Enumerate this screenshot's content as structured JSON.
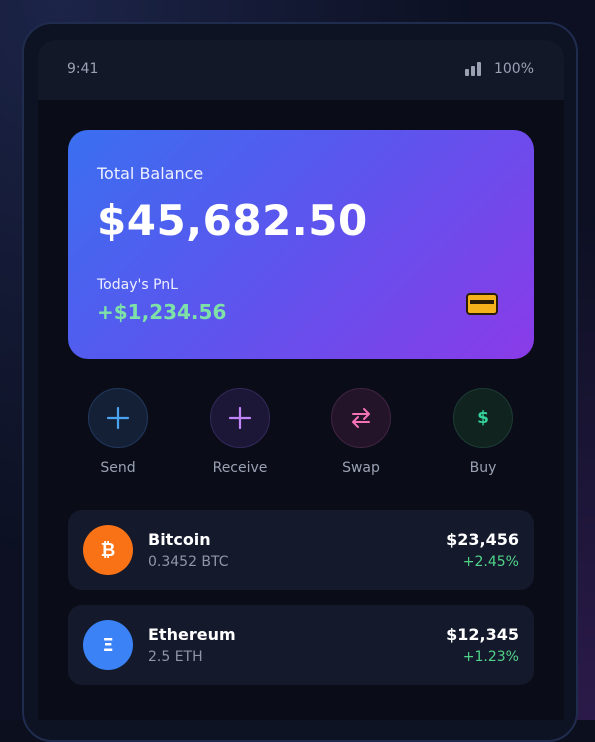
{
  "status_bar": {
    "time": "9:41",
    "battery": "100%",
    "signal_icon": "signal-bars-icon"
  },
  "balance_card": {
    "label": "Total Balance",
    "amount": "$45,682.50",
    "pnl_label": "Today's PnL",
    "pnl_value": "+$1,234.56",
    "card_icon": "credit-card-icon",
    "gradient": [
      "#3a6ff0",
      "#5a56ee",
      "#8a3be8"
    ],
    "pnl_color": "#7ee2a8"
  },
  "actions": [
    {
      "label": "Send",
      "icon": "plus-icon",
      "color": "#4aa3f0"
    },
    {
      "label": "Receive",
      "icon": "plus-icon",
      "color": "#c084fc"
    },
    {
      "label": "Swap",
      "icon": "swap-arrows-icon",
      "color": "#f472b6"
    },
    {
      "label": "Buy",
      "icon": "dollar-icon",
      "glyph": "$",
      "color": "#34d399"
    }
  ],
  "assets": [
    {
      "name": "Bitcoin",
      "amount": "0.3452 BTC",
      "value": "$23,456",
      "change": "+2.45%",
      "icon_glyph": "₿",
      "icon_color": "#f97316",
      "icon": "bitcoin-icon"
    },
    {
      "name": "Ethereum",
      "amount": "2.5 ETH",
      "value": "$12,345",
      "change": "+1.23%",
      "icon_glyph": "Ξ",
      "icon_color": "#3b82f6",
      "icon": "ethereum-icon"
    }
  ]
}
